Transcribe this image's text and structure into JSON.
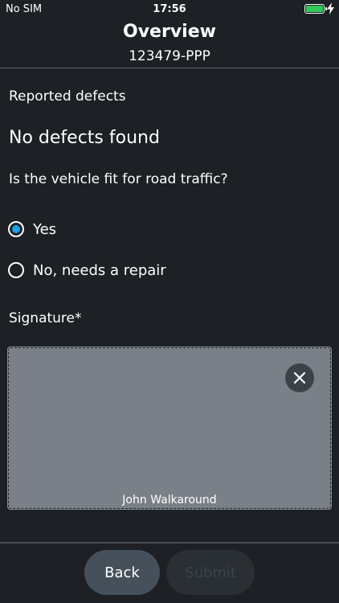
{
  "status_bar": {
    "carrier": "No SIM",
    "time": "17:56",
    "battery_level": 1.0,
    "battery_color": "#34c759",
    "charging_icon": "bolt-icon"
  },
  "header": {
    "title": "Overview",
    "subtitle": "123479-PPP"
  },
  "main": {
    "reported_defects_label": "Reported defects",
    "defects_status": "No defects found",
    "question": "Is the vehicle fit for road traffic?",
    "options": [
      {
        "label": "Yes",
        "selected": true
      },
      {
        "label": "No, needs a repair",
        "selected": false
      }
    ],
    "signature_label": "Signature*",
    "signature": {
      "signer_name": "John Walkaround",
      "clear_icon": "close-icon"
    }
  },
  "footer": {
    "back_label": "Back",
    "submit_label": "Submit",
    "submit_enabled": false
  },
  "colors": {
    "background": "#1d2024",
    "accent": "#1aa3e8",
    "signature_pad": "#7a8087"
  }
}
